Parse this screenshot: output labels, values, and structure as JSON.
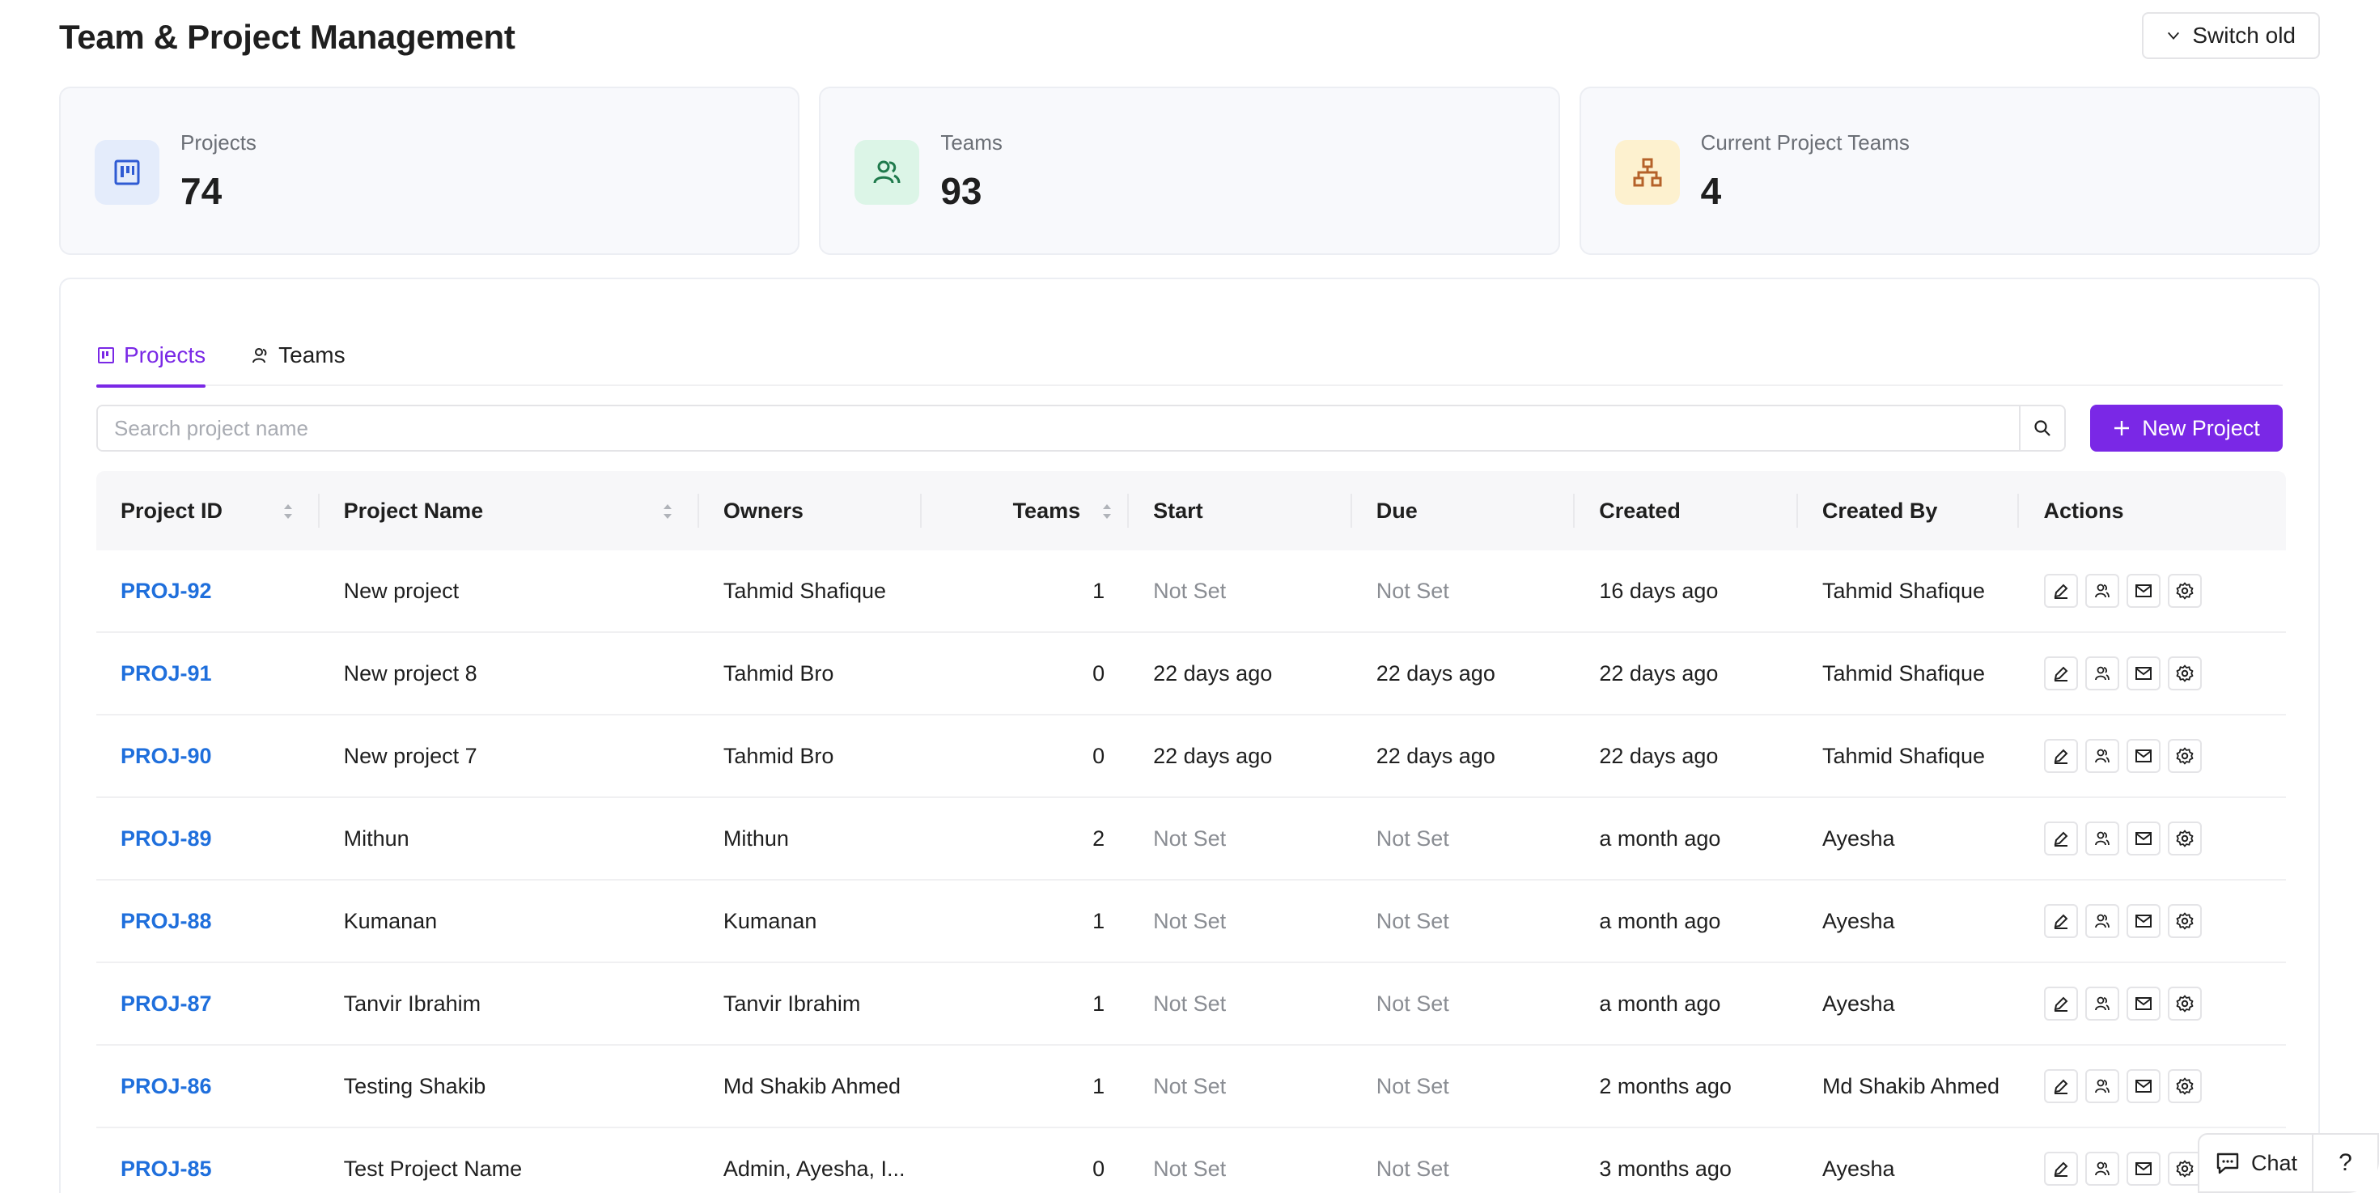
{
  "page": {
    "title": "Team & Project Management",
    "switch_label": "Switch old"
  },
  "stats": [
    {
      "label": "Projects",
      "value": "74",
      "icon": "kanban-icon",
      "bg": "#e4ecfb",
      "fg": "#2f5bd3"
    },
    {
      "label": "Teams",
      "value": "93",
      "icon": "users-icon",
      "bg": "#dcf5e7",
      "fg": "#1f7a4c"
    },
    {
      "label": "Current Project Teams",
      "value": "4",
      "icon": "hierarchy-icon",
      "bg": "#fdf1cf",
      "fg": "#b5622a"
    }
  ],
  "tabs": [
    {
      "label": "Projects",
      "icon": "kanban-icon",
      "active": true
    },
    {
      "label": "Teams",
      "icon": "users-icon",
      "active": false
    }
  ],
  "search": {
    "placeholder": "Search project name"
  },
  "new_project_label": "New Project",
  "table": {
    "columns": [
      "Project ID",
      "Project Name",
      "Owners",
      "Teams",
      "Start",
      "Due",
      "Created",
      "Created By",
      "Actions"
    ],
    "rows": [
      {
        "id": "PROJ-92",
        "name": "New project",
        "owners": "Tahmid Shafique",
        "teams": "1",
        "start": "Not Set",
        "due": "Not Set",
        "created": "16 days ago",
        "created_by": "Tahmid Shafique"
      },
      {
        "id": "PROJ-91",
        "name": "New project 8",
        "owners": "Tahmid Bro",
        "teams": "0",
        "start": "22 days ago",
        "due": "22 days ago",
        "created": "22 days ago",
        "created_by": "Tahmid Shafique"
      },
      {
        "id": "PROJ-90",
        "name": "New project 7",
        "owners": "Tahmid Bro",
        "teams": "0",
        "start": "22 days ago",
        "due": "22 days ago",
        "created": "22 days ago",
        "created_by": "Tahmid Shafique"
      },
      {
        "id": "PROJ-89",
        "name": "Mithun",
        "owners": "Mithun",
        "teams": "2",
        "start": "Not Set",
        "due": "Not Set",
        "created": "a month ago",
        "created_by": "Ayesha"
      },
      {
        "id": "PROJ-88",
        "name": "Kumanan",
        "owners": "Kumanan",
        "teams": "1",
        "start": "Not Set",
        "due": "Not Set",
        "created": "a month ago",
        "created_by": "Ayesha"
      },
      {
        "id": "PROJ-87",
        "name": "Tanvir Ibrahim",
        "owners": "Tanvir Ibrahim",
        "teams": "1",
        "start": "Not Set",
        "due": "Not Set",
        "created": "a month ago",
        "created_by": "Ayesha"
      },
      {
        "id": "PROJ-86",
        "name": "Testing Shakib",
        "owners": "Md Shakib Ahmed",
        "teams": "1",
        "start": "Not Set",
        "due": "Not Set",
        "created": "2 months ago",
        "created_by": "Md Shakib Ahmed"
      },
      {
        "id": "PROJ-85",
        "name": "Test Project Name",
        "owners": "Admin, Ayesha, I...",
        "teams": "0",
        "start": "Not Set",
        "due": "Not Set",
        "created": "3 months ago",
        "created_by": "Ayesha"
      }
    ],
    "actions": [
      "edit-icon",
      "users-icon",
      "mail-icon",
      "settings-icon"
    ]
  },
  "chat": {
    "label": "Chat",
    "help": "?"
  },
  "colors": {
    "accent": "#7a28e6",
    "link": "#1f6fdc",
    "muted": "#8a8d93"
  }
}
